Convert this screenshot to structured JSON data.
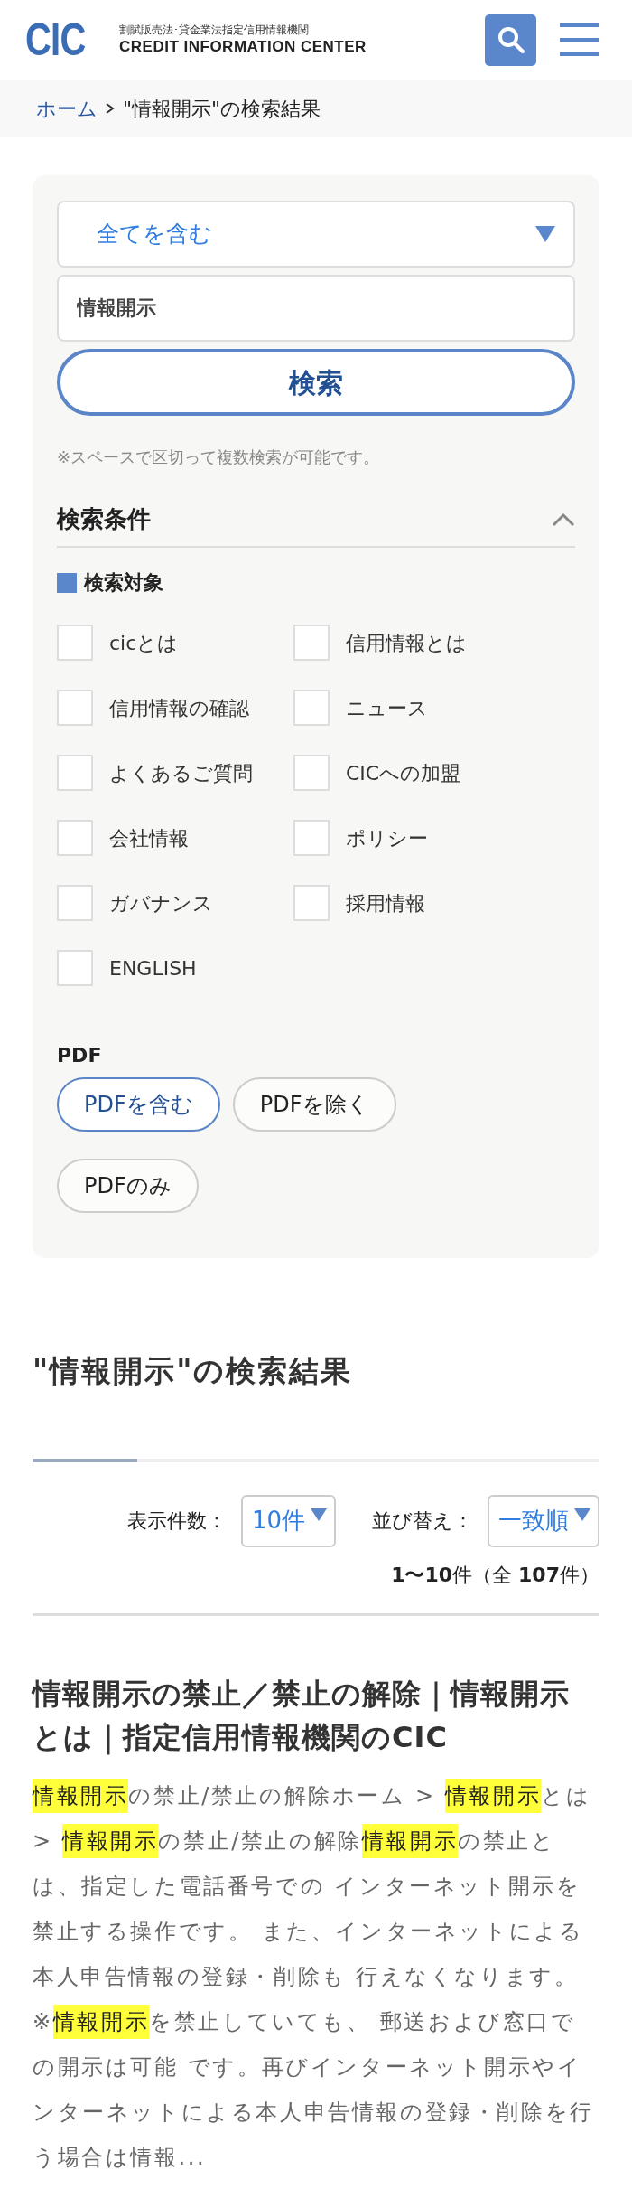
{
  "header": {
    "logo": "CIC",
    "tagline": "割賦販売法･貸金業法指定信用情報機関",
    "org_name": "CREDIT INFORMATION CENTER"
  },
  "breadcrumb": [
    {
      "label": "ホーム",
      "link": true
    },
    {
      "label": "\"情報開示\"の検索結果",
      "link": false
    }
  ],
  "search": {
    "mode": "全てを含む",
    "query": "情報開示",
    "button": "検索",
    "note": "※スペースで区切って複数検索が可能です。"
  },
  "conditions": {
    "title": "検索条件",
    "expanded": true,
    "target_title": "検索対象",
    "targets": [
      {
        "label": "cicとは",
        "checked": false
      },
      {
        "label": "信用情報とは",
        "checked": false
      },
      {
        "label": "信用情報の確認",
        "checked": false
      },
      {
        "label": "ニュース",
        "checked": false
      },
      {
        "label": "よくあるご質問",
        "checked": false
      },
      {
        "label": "CICへの加盟",
        "checked": false
      },
      {
        "label": "会社情報",
        "checked": false
      },
      {
        "label": "ポリシー",
        "checked": false
      },
      {
        "label": "ガバナンス",
        "checked": false
      },
      {
        "label": "採用情報",
        "checked": false
      },
      {
        "label": "ENGLISH",
        "checked": false
      }
    ],
    "pdf_title": "PDF",
    "pdf_options": [
      {
        "label": "PDFを含む",
        "selected": true
      },
      {
        "label": "PDFを除く",
        "selected": false
      },
      {
        "label": "PDFのみ",
        "selected": false
      }
    ]
  },
  "results": {
    "title": "\"情報開示\"の検索結果",
    "per_page_label": "表示件数：",
    "per_page": "10件",
    "sort_label": "並び替え：",
    "sort": "一致順",
    "count": "**1〜10**件（全 **107**件）",
    "items": [
      {
        "title": "情報開示の禁止／禁止の解除｜情報開示とは｜指定信用情報機関のCIC",
        "snippet": [
          {
            "text": "情報開示",
            "highlight": true
          },
          {
            "text": "の禁止/禁止の解除ホーム > ",
            "highlight": false
          },
          {
            "text": "情報開示",
            "highlight": true
          },
          {
            "text": "とは > ",
            "highlight": false
          },
          {
            "text": "情報開示",
            "highlight": true
          },
          {
            "text": "の禁止/禁止の解除",
            "highlight": false
          },
          {
            "text": "情報開示",
            "highlight": true
          },
          {
            "text": "の禁止とは、指定した電話番号での インターネット開示を禁止する操作です。 また、インターネットによる本人申告情報の登録・削除も 行えなくなります。 ※",
            "highlight": false
          },
          {
            "text": "情報開示",
            "highlight": true
          },
          {
            "text": "を禁止していても、 郵送および窓口での開示は可能 です。再びインターネット開示やインターネットによる本人申告情報の登録・削除を行う場合は情報...",
            "highlight": false
          }
        ]
      }
    ]
  }
}
